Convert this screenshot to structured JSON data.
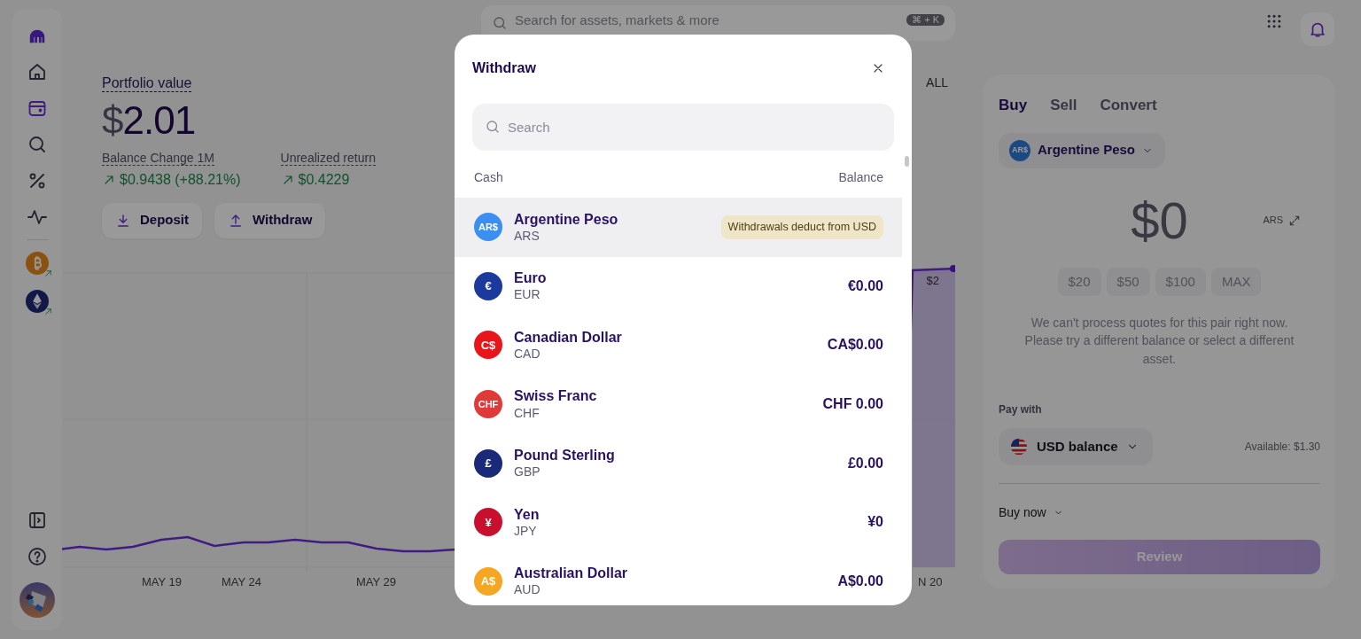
{
  "sidebar": {
    "nav": [
      {
        "kind": "home",
        "selected": false
      },
      {
        "kind": "wallet",
        "selected": true
      },
      {
        "kind": "search",
        "selected": false
      },
      {
        "kind": "percent",
        "selected": false
      },
      {
        "kind": "activity",
        "selected": false
      }
    ],
    "assets": [
      {
        "kind": "bitcoin",
        "rising": true
      },
      {
        "kind": "ethereum",
        "rising": true
      }
    ]
  },
  "search": {
    "placeholder": "Search for assets, markets & more",
    "shortcut": "⌘ + K"
  },
  "portfolio": {
    "label": "Portfolio value",
    "currency": "$",
    "amount": "2.01"
  },
  "stats": [
    {
      "label": "Balance Change 1M",
      "value": "$0.9438 (+88.21%)",
      "rising": true
    },
    {
      "label": "Unrealized return",
      "value": "$0.4229",
      "rising": true
    }
  ],
  "actions": [
    {
      "label": "Deposit",
      "kind": "deposit"
    },
    {
      "label": "Withdraw",
      "kind": "withdraw"
    }
  ],
  "range_label": "ALL",
  "chart": {
    "x_labels": [
      "MAY 19",
      "MAY 24",
      "MAY 29",
      "N 20"
    ],
    "end_label": "$2"
  },
  "trade": {
    "tabs": [
      {
        "label": "Buy",
        "selected": true
      },
      {
        "label": "Sell",
        "selected": false
      },
      {
        "label": "Convert",
        "selected": false
      }
    ],
    "asset": {
      "icon_text": "AR$",
      "name": "Argentine Peso"
    },
    "amount": "$0",
    "unit": "ARS",
    "quick_amounts": [
      "$20",
      "$50",
      "$100",
      "MAX"
    ],
    "message": "We can't process quotes for this pair right now. Please try a different balance or select a different asset.",
    "pay_with_label": "Pay with",
    "pay_with": "USD balance",
    "available": "Available: $1.30",
    "order_type": "Buy now",
    "submit": {
      "label": "Review",
      "disabled": true
    }
  },
  "modal": {
    "title": "Withdraw",
    "search_placeholder": "Search",
    "columns": [
      "Cash",
      "Balance"
    ],
    "rows": [
      {
        "icon_text": "AR$",
        "color": "#3b8ff0",
        "name": "Argentine Peso",
        "code": "ARS",
        "kind": "note",
        "value": "Withdrawals deduct from USD",
        "selected": true
      },
      {
        "icon_text": "€",
        "color": "#1c3a9e",
        "name": "Euro",
        "code": "EUR",
        "kind": "balance",
        "value": "€0.00",
        "selected": false
      },
      {
        "icon_text": "C$",
        "color": "#e8161b",
        "name": "Canadian Dollar",
        "code": "CAD",
        "kind": "balance",
        "value": "CA$0.00",
        "selected": false
      },
      {
        "icon_text": "CHF",
        "color": "#e0393a",
        "name": "Swiss Franc",
        "code": "CHF",
        "kind": "balance",
        "value": "CHF 0.00",
        "selected": false
      },
      {
        "icon_text": "£",
        "color": "#1b2a78",
        "name": "Pound Sterling",
        "code": "GBP",
        "kind": "balance",
        "value": "£0.00",
        "selected": false
      },
      {
        "icon_text": "¥",
        "color": "#c8102e",
        "name": "Yen",
        "code": "JPY",
        "kind": "balance",
        "value": "¥0",
        "selected": false
      },
      {
        "icon_text": "A$",
        "color": "#f5a623",
        "name": "Australian Dollar",
        "code": "AUD",
        "kind": "balance",
        "value": "A$0.00",
        "selected": false
      }
    ]
  }
}
